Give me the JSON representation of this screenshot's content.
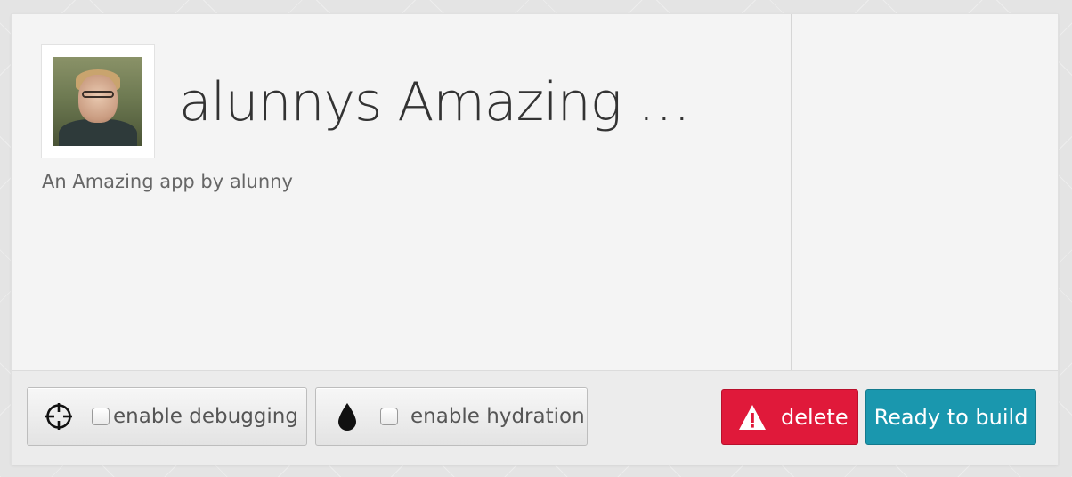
{
  "app": {
    "title": "alunnys Amazing …",
    "subtitle": "An Amazing app by alunny"
  },
  "options": {
    "debugging": {
      "label": "enable debugging",
      "checked": false,
      "icon": "crosshair-icon"
    },
    "hydration": {
      "label": "enable hydration",
      "checked": false,
      "icon": "droplet-icon"
    }
  },
  "actions": {
    "delete_label": "delete",
    "delete_icon": "warning-icon",
    "build_label": "Ready to build"
  },
  "colors": {
    "delete": "#e0193a",
    "build": "#1a97ae",
    "background": "#f4f4f4"
  }
}
